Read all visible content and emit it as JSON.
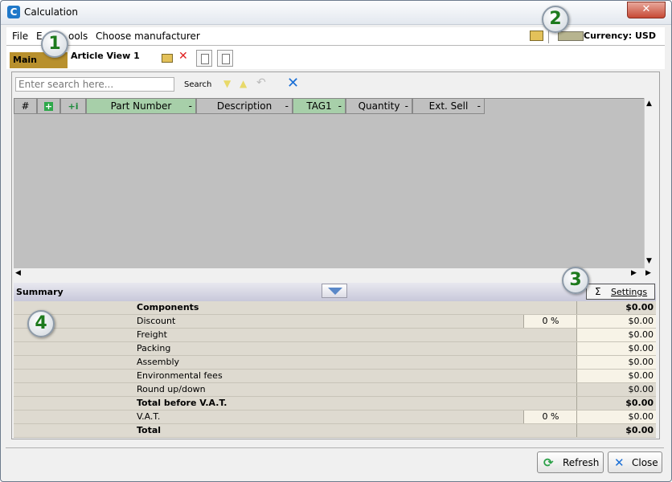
{
  "window": {
    "title": "Calculation",
    "close_symbol": "✕",
    "app_icon_letter": "C"
  },
  "menu": {
    "file": "File",
    "edit": "E",
    "tools": "ools",
    "choose_manufacturer": "Choose manufacturer"
  },
  "currency": {
    "label": "Currency: USD"
  },
  "tabs": {
    "main": "Main",
    "article_view": "Article View 1"
  },
  "search": {
    "placeholder": "Enter search here...",
    "label": "Search"
  },
  "grid": {
    "columns": [
      {
        "label": "#",
        "dash": ""
      },
      {
        "label": "",
        "dash": ""
      },
      {
        "label": "",
        "dash": ""
      },
      {
        "label": "Part Number",
        "dash": "-"
      },
      {
        "label": "Description",
        "dash": "-"
      },
      {
        "label": "TAG1",
        "dash": "-"
      },
      {
        "label": "Quantity",
        "dash": "-"
      },
      {
        "label": "Ext. Sell",
        "dash": "-"
      }
    ],
    "colors": {
      "header_green": "#a7cfa9",
      "header_gray": "#c0c0c0",
      "body": "#c0c0c0"
    }
  },
  "summary": {
    "title": "Summary",
    "settings_sigma": "Σ",
    "settings_label": "Settings",
    "rows": [
      {
        "label": "Components",
        "pct": "",
        "amount": "$0.00"
      },
      {
        "label": "Discount",
        "pct": "0 %",
        "amount": "$0.00"
      },
      {
        "label": "Freight",
        "pct": "",
        "amount": "$0.00"
      },
      {
        "label": "Packing",
        "pct": "",
        "amount": "$0.00"
      },
      {
        "label": "Assembly",
        "pct": "",
        "amount": "$0.00"
      },
      {
        "label": "Environmental fees",
        "pct": "",
        "amount": "$0.00"
      },
      {
        "label": "Round up/down",
        "pct": "",
        "amount": "$0.00"
      },
      {
        "label": "Total before V.A.T.",
        "pct": "",
        "amount": "$0.00"
      },
      {
        "label": "V.A.T.",
        "pct": "0 %",
        "amount": "$0.00"
      },
      {
        "label": "Total",
        "pct": "",
        "amount": "$0.00"
      }
    ]
  },
  "footer": {
    "refresh_label": "Refresh",
    "close_label": "Close"
  },
  "callouts": [
    "1",
    "2",
    "3",
    "4"
  ],
  "colors": {
    "main_tab": "#b8902d",
    "summary_row": "#dedad0",
    "callout_text": "#1d7a1d"
  }
}
